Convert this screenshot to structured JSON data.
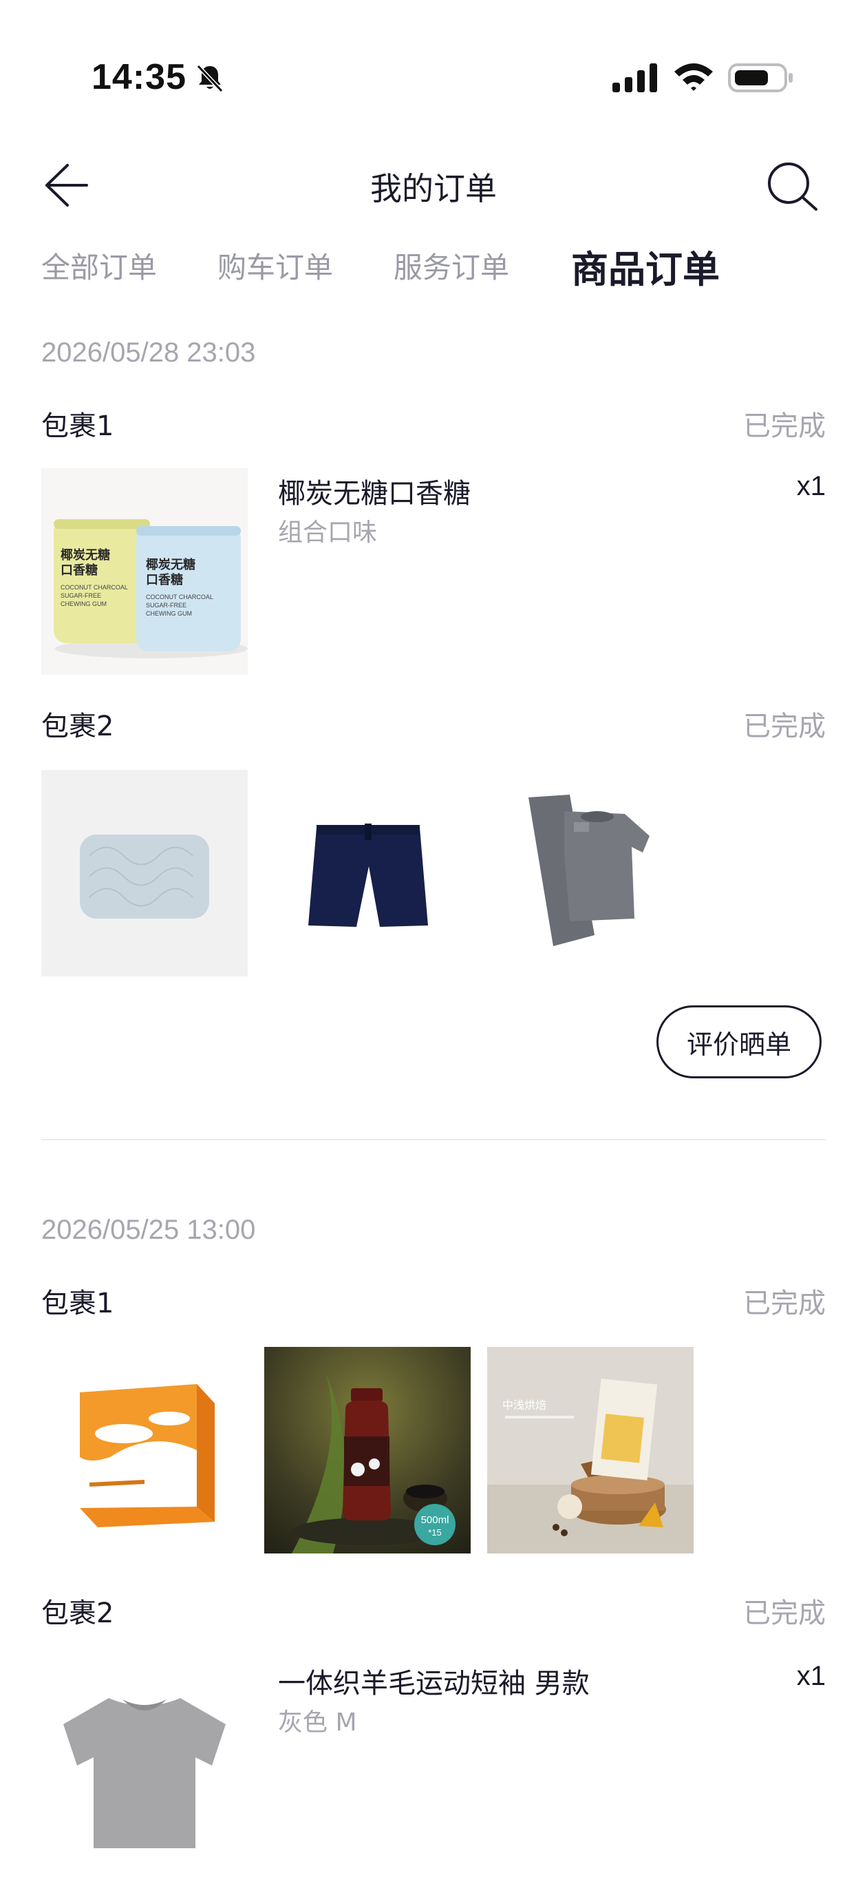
{
  "status_bar": {
    "time": "14:35"
  },
  "nav": {
    "title": "我的订单"
  },
  "tabs": [
    {
      "label": "全部订单",
      "active": false
    },
    {
      "label": "购车订单",
      "active": false
    },
    {
      "label": "服务订单",
      "active": false
    },
    {
      "label": "商品订单",
      "active": true
    }
  ],
  "orders": [
    {
      "date": "2026/05/28 23:03",
      "packages": [
        {
          "label": "包裹1",
          "status": "已完成",
          "item": {
            "name": "椰炭无糖口香糖",
            "spec": "组合口味",
            "qty": "x1"
          },
          "image_text": {
            "product": "椰炭无糖",
            "product2": "口香糖",
            "en1": "COCONUT CHARCOAL",
            "en2": "SUGAR-FREE",
            "en3": "CHEWING GUM"
          }
        },
        {
          "label": "包裹2",
          "status": "已完成"
        }
      ],
      "review_label": "评价晒单"
    },
    {
      "date": "2026/05/25 13:00",
      "packages": [
        {
          "label": "包裹1",
          "status": "已完成",
          "image_text": {
            "bottle": "500ml",
            "bottle2": "*15",
            "bake": "中浅烘焙"
          }
        },
        {
          "label": "包裹2",
          "status": "已完成",
          "item": {
            "name": "一体织羊毛运动短袖 男款",
            "spec": "灰色 M",
            "qty": "x1"
          }
        }
      ]
    }
  ],
  "colors": {
    "text": "#1a1a2a",
    "muted": "#a6a6b0",
    "tab_inactive": "#9a9aa6"
  }
}
